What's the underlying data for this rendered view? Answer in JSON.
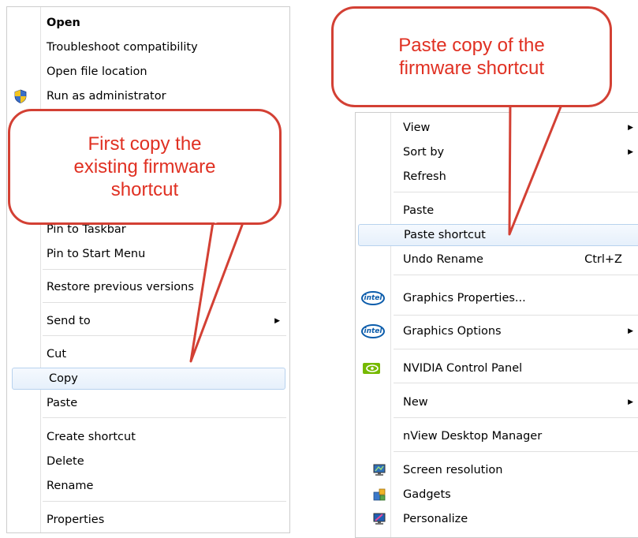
{
  "left_menu": {
    "items": [
      {
        "label": "Open"
      },
      {
        "label": "Troubleshoot compatibility"
      },
      {
        "label": "Open file location"
      },
      {
        "label": "Run as administrator",
        "icon": "uac-shield-icon"
      },
      {
        "label": "Pin to Taskbar"
      },
      {
        "label": "Pin to Start Menu"
      },
      {
        "label": "Restore previous versions"
      },
      {
        "label": "Send to"
      },
      {
        "label": "Cut"
      },
      {
        "label": "Copy"
      },
      {
        "label": "Paste"
      },
      {
        "label": "Create shortcut"
      },
      {
        "label": "Delete"
      },
      {
        "label": "Rename"
      },
      {
        "label": "Properties"
      }
    ]
  },
  "right_menu": {
    "items": [
      {
        "label": "View"
      },
      {
        "label": "Sort by"
      },
      {
        "label": "Refresh"
      },
      {
        "label": "Paste"
      },
      {
        "label": "Paste shortcut"
      },
      {
        "label": "Undo Rename",
        "shortcut": "Ctrl+Z"
      },
      {
        "label": "Graphics Properties...",
        "icon": "intel-icon",
        "icon_text": "intel"
      },
      {
        "label": "Graphics Options",
        "icon": "intel-icon",
        "icon_text": "intel"
      },
      {
        "label": "NVIDIA Control Panel",
        "icon": "nvidia-icon"
      },
      {
        "label": "New"
      },
      {
        "label": "nView Desktop Manager"
      },
      {
        "label": "Screen resolution",
        "icon": "monitor-icon"
      },
      {
        "label": "Gadgets",
        "icon": "gadgets-icon"
      },
      {
        "label": "Personalize",
        "icon": "personalize-icon"
      }
    ]
  },
  "callouts": {
    "left": {
      "line1": "First copy the",
      "line2": "existing firmware",
      "line3": "shortcut"
    },
    "right": {
      "line1": "Paste copy of the",
      "line2": "firmware shortcut"
    }
  },
  "colors": {
    "callout_border": "#d34034",
    "callout_text": "#e03022",
    "highlight_border": "#b8d2ee",
    "highlight_fill": "#e6f0fb",
    "intel_blue": "#0b5cab",
    "nvidia_green": "#76b900"
  },
  "arrow_glyph": "▶"
}
